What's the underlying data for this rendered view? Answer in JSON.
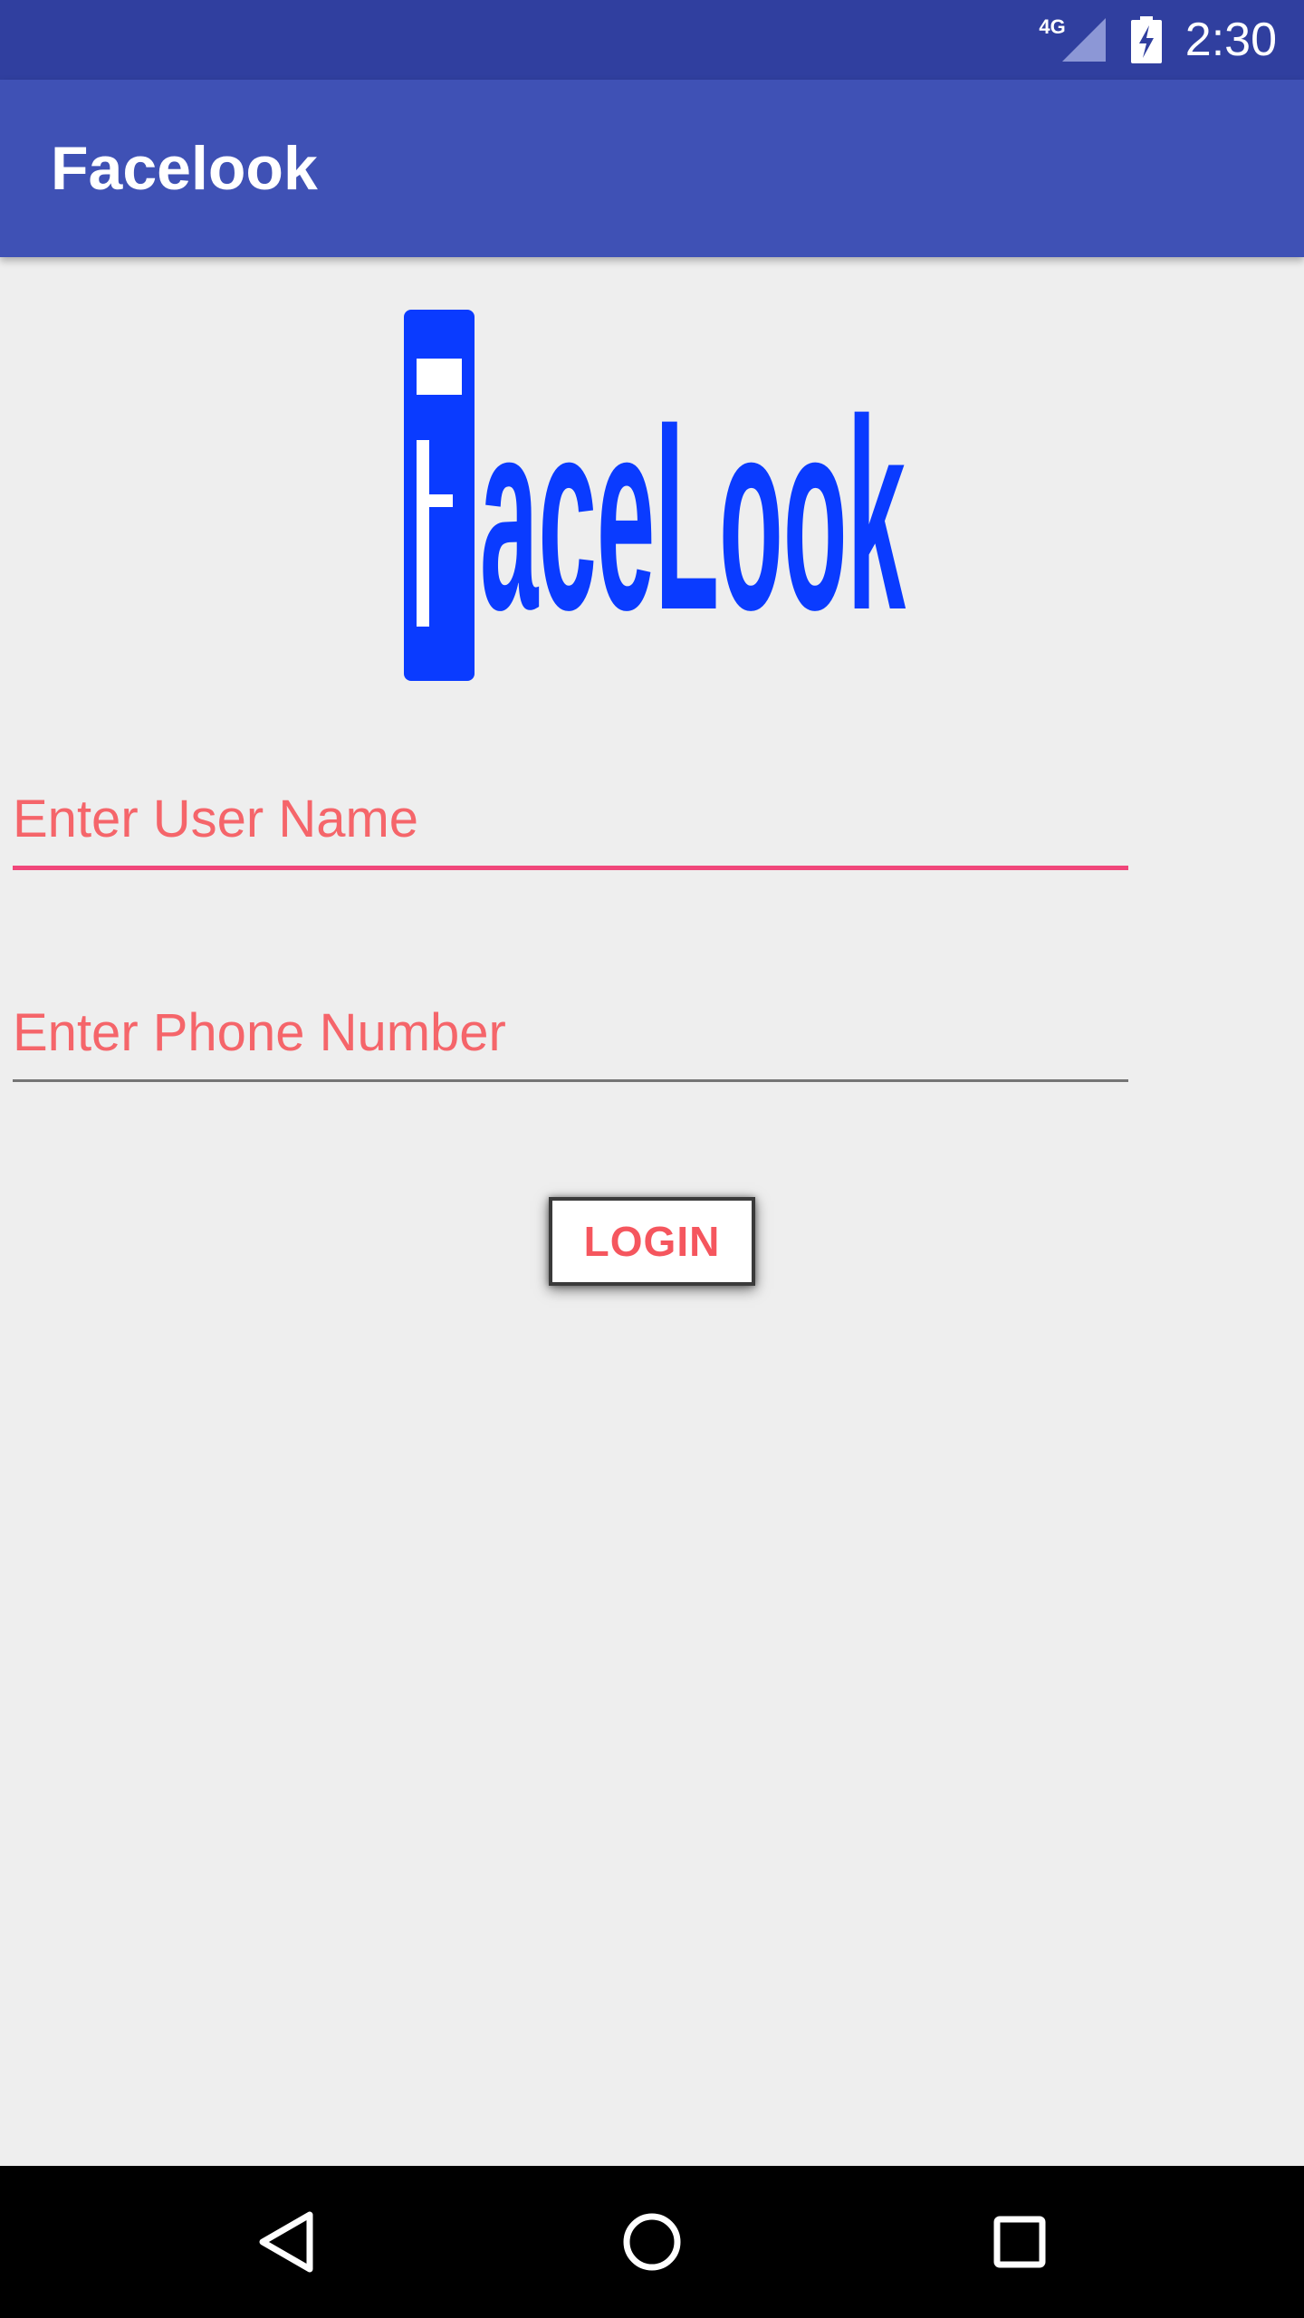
{
  "status_bar": {
    "network": "4G",
    "time": "2:30",
    "signal_icon": "cell-signal-icon",
    "battery_icon": "battery-charging-icon",
    "color": "#303f9f"
  },
  "app_bar": {
    "title": "Facelook",
    "color": "#3f51b5"
  },
  "logo": {
    "text": "FaceLook",
    "color": "#0a3bff"
  },
  "form": {
    "username": {
      "placeholder": "Enter User Name",
      "value": "",
      "focused": true
    },
    "phone": {
      "placeholder": "Enter Phone Number",
      "value": "",
      "focused": false
    },
    "accent_color": "#f0467a",
    "hint_color": "#f5656a"
  },
  "login_button": {
    "label": "LOGIN"
  },
  "nav_bar": {
    "back_icon": "back-triangle-icon",
    "home_icon": "home-circle-icon",
    "recents_icon": "recents-square-icon"
  }
}
